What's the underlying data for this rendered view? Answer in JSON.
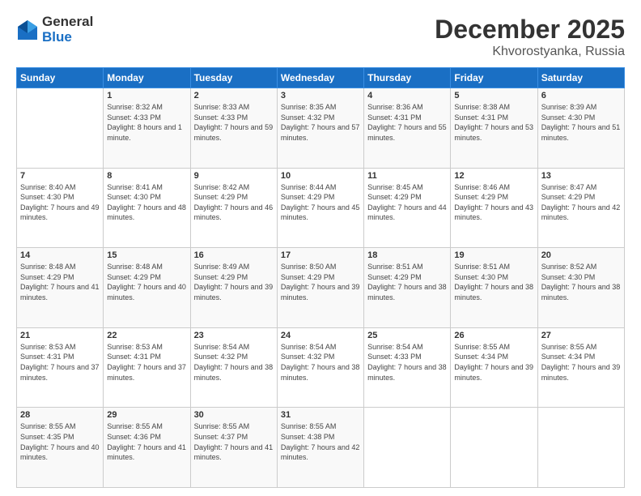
{
  "header": {
    "logo": {
      "general": "General",
      "blue": "Blue"
    },
    "title": "December 2025",
    "location": "Khvorostyanka, Russia"
  },
  "days_of_week": [
    "Sunday",
    "Monday",
    "Tuesday",
    "Wednesday",
    "Thursday",
    "Friday",
    "Saturday"
  ],
  "weeks": [
    [
      {
        "day": "",
        "sunrise": "",
        "sunset": "",
        "daylight": ""
      },
      {
        "day": "1",
        "sunrise": "Sunrise: 8:32 AM",
        "sunset": "Sunset: 4:33 PM",
        "daylight": "Daylight: 8 hours and 1 minute."
      },
      {
        "day": "2",
        "sunrise": "Sunrise: 8:33 AM",
        "sunset": "Sunset: 4:33 PM",
        "daylight": "Daylight: 7 hours and 59 minutes."
      },
      {
        "day": "3",
        "sunrise": "Sunrise: 8:35 AM",
        "sunset": "Sunset: 4:32 PM",
        "daylight": "Daylight: 7 hours and 57 minutes."
      },
      {
        "day": "4",
        "sunrise": "Sunrise: 8:36 AM",
        "sunset": "Sunset: 4:31 PM",
        "daylight": "Daylight: 7 hours and 55 minutes."
      },
      {
        "day": "5",
        "sunrise": "Sunrise: 8:38 AM",
        "sunset": "Sunset: 4:31 PM",
        "daylight": "Daylight: 7 hours and 53 minutes."
      },
      {
        "day": "6",
        "sunrise": "Sunrise: 8:39 AM",
        "sunset": "Sunset: 4:30 PM",
        "daylight": "Daylight: 7 hours and 51 minutes."
      }
    ],
    [
      {
        "day": "7",
        "sunrise": "Sunrise: 8:40 AM",
        "sunset": "Sunset: 4:30 PM",
        "daylight": "Daylight: 7 hours and 49 minutes."
      },
      {
        "day": "8",
        "sunrise": "Sunrise: 8:41 AM",
        "sunset": "Sunset: 4:30 PM",
        "daylight": "Daylight: 7 hours and 48 minutes."
      },
      {
        "day": "9",
        "sunrise": "Sunrise: 8:42 AM",
        "sunset": "Sunset: 4:29 PM",
        "daylight": "Daylight: 7 hours and 46 minutes."
      },
      {
        "day": "10",
        "sunrise": "Sunrise: 8:44 AM",
        "sunset": "Sunset: 4:29 PM",
        "daylight": "Daylight: 7 hours and 45 minutes."
      },
      {
        "day": "11",
        "sunrise": "Sunrise: 8:45 AM",
        "sunset": "Sunset: 4:29 PM",
        "daylight": "Daylight: 7 hours and 44 minutes."
      },
      {
        "day": "12",
        "sunrise": "Sunrise: 8:46 AM",
        "sunset": "Sunset: 4:29 PM",
        "daylight": "Daylight: 7 hours and 43 minutes."
      },
      {
        "day": "13",
        "sunrise": "Sunrise: 8:47 AM",
        "sunset": "Sunset: 4:29 PM",
        "daylight": "Daylight: 7 hours and 42 minutes."
      }
    ],
    [
      {
        "day": "14",
        "sunrise": "Sunrise: 8:48 AM",
        "sunset": "Sunset: 4:29 PM",
        "daylight": "Daylight: 7 hours and 41 minutes."
      },
      {
        "day": "15",
        "sunrise": "Sunrise: 8:48 AM",
        "sunset": "Sunset: 4:29 PM",
        "daylight": "Daylight: 7 hours and 40 minutes."
      },
      {
        "day": "16",
        "sunrise": "Sunrise: 8:49 AM",
        "sunset": "Sunset: 4:29 PM",
        "daylight": "Daylight: 7 hours and 39 minutes."
      },
      {
        "day": "17",
        "sunrise": "Sunrise: 8:50 AM",
        "sunset": "Sunset: 4:29 PM",
        "daylight": "Daylight: 7 hours and 39 minutes."
      },
      {
        "day": "18",
        "sunrise": "Sunrise: 8:51 AM",
        "sunset": "Sunset: 4:29 PM",
        "daylight": "Daylight: 7 hours and 38 minutes."
      },
      {
        "day": "19",
        "sunrise": "Sunrise: 8:51 AM",
        "sunset": "Sunset: 4:30 PM",
        "daylight": "Daylight: 7 hours and 38 minutes."
      },
      {
        "day": "20",
        "sunrise": "Sunrise: 8:52 AM",
        "sunset": "Sunset: 4:30 PM",
        "daylight": "Daylight: 7 hours and 38 minutes."
      }
    ],
    [
      {
        "day": "21",
        "sunrise": "Sunrise: 8:53 AM",
        "sunset": "Sunset: 4:31 PM",
        "daylight": "Daylight: 7 hours and 37 minutes."
      },
      {
        "day": "22",
        "sunrise": "Sunrise: 8:53 AM",
        "sunset": "Sunset: 4:31 PM",
        "daylight": "Daylight: 7 hours and 37 minutes."
      },
      {
        "day": "23",
        "sunrise": "Sunrise: 8:54 AM",
        "sunset": "Sunset: 4:32 PM",
        "daylight": "Daylight: 7 hours and 38 minutes."
      },
      {
        "day": "24",
        "sunrise": "Sunrise: 8:54 AM",
        "sunset": "Sunset: 4:32 PM",
        "daylight": "Daylight: 7 hours and 38 minutes."
      },
      {
        "day": "25",
        "sunrise": "Sunrise: 8:54 AM",
        "sunset": "Sunset: 4:33 PM",
        "daylight": "Daylight: 7 hours and 38 minutes."
      },
      {
        "day": "26",
        "sunrise": "Sunrise: 8:55 AM",
        "sunset": "Sunset: 4:34 PM",
        "daylight": "Daylight: 7 hours and 39 minutes."
      },
      {
        "day": "27",
        "sunrise": "Sunrise: 8:55 AM",
        "sunset": "Sunset: 4:34 PM",
        "daylight": "Daylight: 7 hours and 39 minutes."
      }
    ],
    [
      {
        "day": "28",
        "sunrise": "Sunrise: 8:55 AM",
        "sunset": "Sunset: 4:35 PM",
        "daylight": "Daylight: 7 hours and 40 minutes."
      },
      {
        "day": "29",
        "sunrise": "Sunrise: 8:55 AM",
        "sunset": "Sunset: 4:36 PM",
        "daylight": "Daylight: 7 hours and 41 minutes."
      },
      {
        "day": "30",
        "sunrise": "Sunrise: 8:55 AM",
        "sunset": "Sunset: 4:37 PM",
        "daylight": "Daylight: 7 hours and 41 minutes."
      },
      {
        "day": "31",
        "sunrise": "Sunrise: 8:55 AM",
        "sunset": "Sunset: 4:38 PM",
        "daylight": "Daylight: 7 hours and 42 minutes."
      },
      {
        "day": "",
        "sunrise": "",
        "sunset": "",
        "daylight": ""
      },
      {
        "day": "",
        "sunrise": "",
        "sunset": "",
        "daylight": ""
      },
      {
        "day": "",
        "sunrise": "",
        "sunset": "",
        "daylight": ""
      }
    ]
  ]
}
